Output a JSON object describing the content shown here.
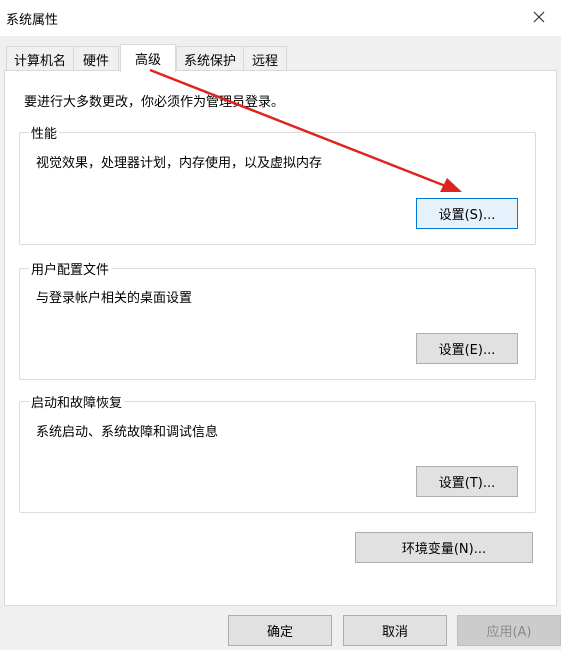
{
  "window": {
    "title": "系统属性",
    "close_icon": "close-icon"
  },
  "tabs": [
    {
      "label": "计算机名"
    },
    {
      "label": "硬件"
    },
    {
      "label": "高级"
    },
    {
      "label": "系统保护"
    },
    {
      "label": "远程"
    }
  ],
  "active_tab": "高级",
  "notice": "要进行大多数更改，你必须作为管理员登录。",
  "groups": {
    "performance": {
      "title": "性能",
      "description": "视觉效果，处理器计划，内存使用，以及虚拟内存",
      "button": "设置(S)..."
    },
    "profiles": {
      "title": "用户配置文件",
      "description": "与登录帐户相关的桌面设置",
      "button": "设置(E)..."
    },
    "startup": {
      "title": "启动和故障恢复",
      "description": "系统启动、系统故障和调试信息",
      "button": "设置(T)..."
    }
  },
  "env_button": "环境变量(N)...",
  "footer": {
    "ok": "确定",
    "cancel": "取消",
    "apply": "应用(A)"
  },
  "colors": {
    "annotation_arrow": "#e0231c",
    "focus_border": "#0078d7"
  }
}
